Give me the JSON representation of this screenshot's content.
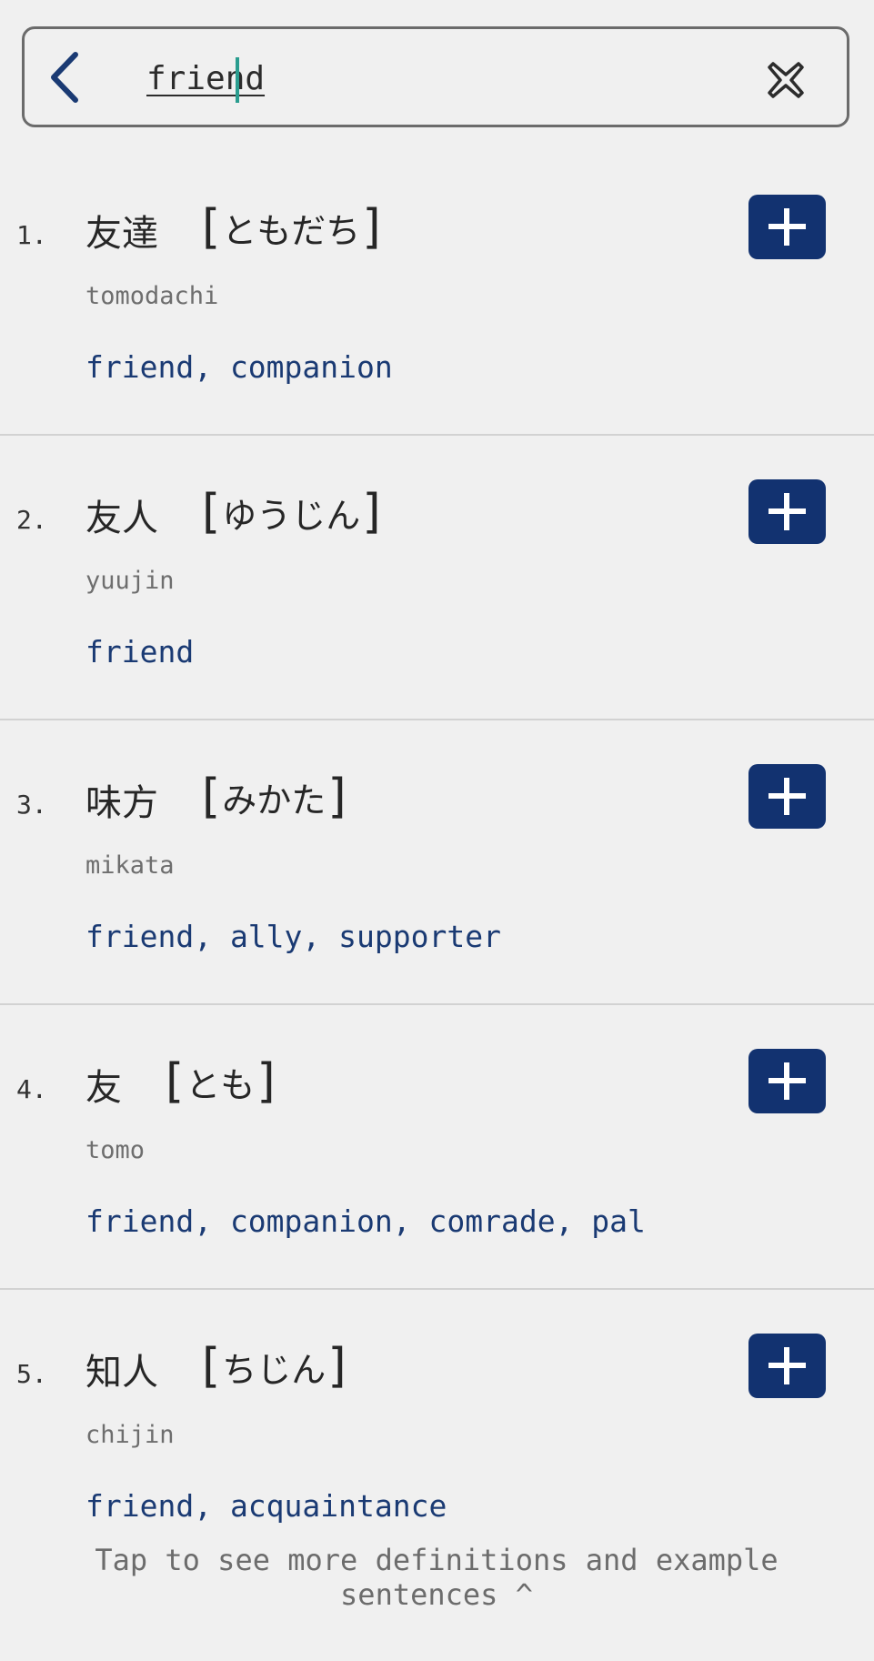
{
  "search": {
    "value": "friend",
    "back_icon": "chevron-left-icon",
    "clear_icon": "clear-x-icon"
  },
  "colors": {
    "background": "#f0f0f0",
    "accent": "#123270",
    "meaning_text": "#1a3a73",
    "caret": "#2a9d8f"
  },
  "entries": [
    {
      "number": "1.",
      "word": "友達",
      "reading": "ともだち",
      "romaji": "tomodachi",
      "meaning": "friend, companion",
      "add_icon": "plus-icon"
    },
    {
      "number": "2.",
      "word": "友人",
      "reading": "ゆうじん",
      "romaji": "yuujin",
      "meaning": "friend",
      "add_icon": "plus-icon"
    },
    {
      "number": "3.",
      "word": "味方",
      "reading": "みかた",
      "romaji": "mikata",
      "meaning": "friend, ally, supporter",
      "add_icon": "plus-icon"
    },
    {
      "number": "4.",
      "word": "友",
      "reading": "とも",
      "romaji": "tomo",
      "meaning": "friend, companion, comrade, pal",
      "add_icon": "plus-icon"
    },
    {
      "number": "5.",
      "word": "知人",
      "reading": "ちじん",
      "romaji": "chijin",
      "meaning": "friend, acquaintance",
      "add_icon": "plus-icon"
    }
  ],
  "footer": {
    "hint_line1": "Tap to see more definitions and example",
    "hint_line2": "sentences ^"
  }
}
